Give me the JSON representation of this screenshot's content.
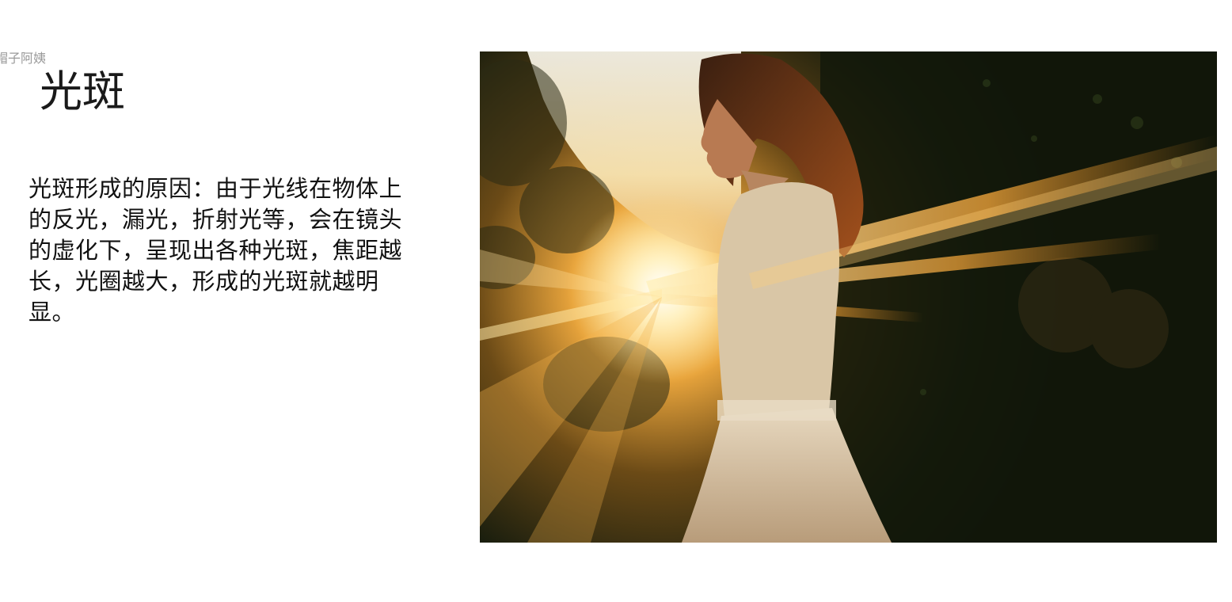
{
  "slide": {
    "watermark": "帽子阿姨",
    "title": "光斑",
    "body": "光斑形成的原因：由于光线在物体上的反光，漏光，折射光等，会在镜头的虚化下，呈现出各种光斑，焦距越长，光圈越大，形成的光斑就越明显。"
  },
  "photo": {
    "subject": "backlit-woman-with-sunlight-flare",
    "colors": {
      "shadow": "#0b0f08",
      "sun": "#fff8dc",
      "flare": "#f0a030",
      "foliage": "#1d2a12"
    }
  }
}
